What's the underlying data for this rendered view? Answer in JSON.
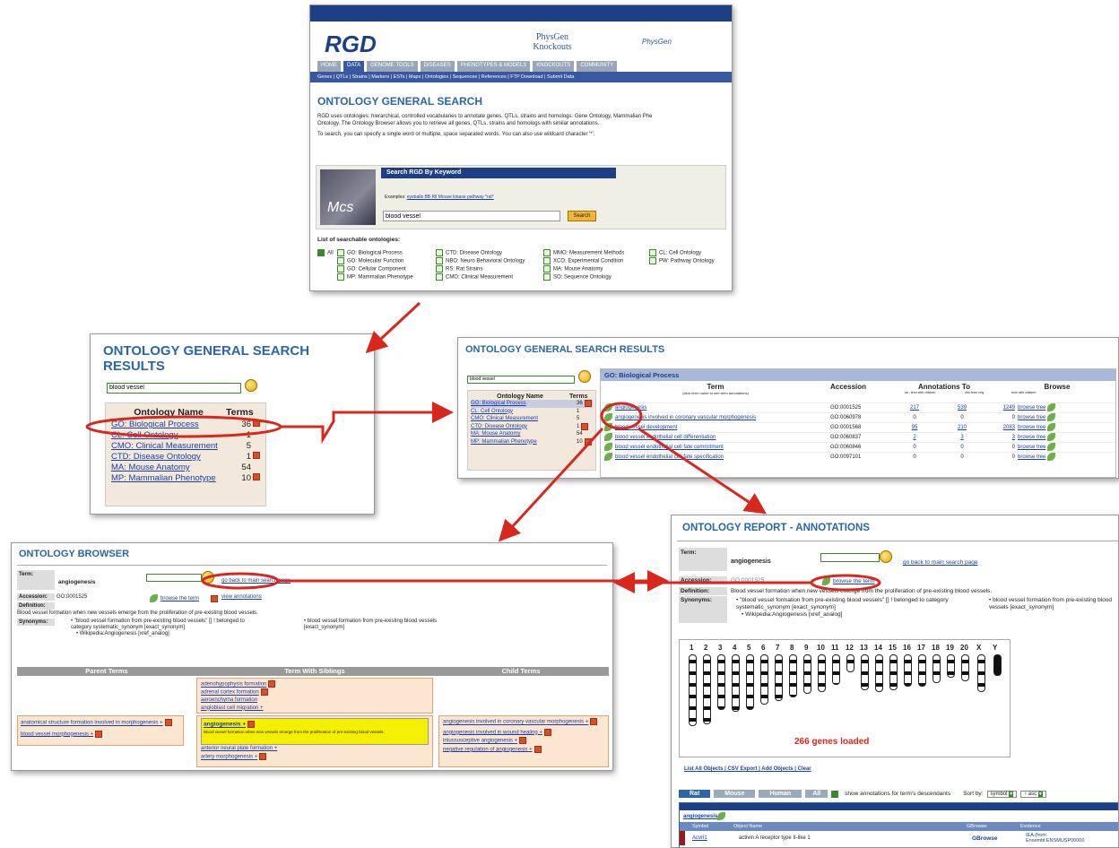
{
  "search_page": {
    "logo_text": "RGD",
    "physgen": "PhysGen Knockouts",
    "physgen2": "PhysGen",
    "nav_tabs": [
      "HOME",
      "DATA",
      "GENOME TOOLS",
      "DISEASES",
      "PHENOTYPES & MODELS",
      "KNOCKOUTS",
      "COMMUNITY"
    ],
    "subnav": "Genes | QTLs | Strains | Markers | ESTs | Maps | Ontologies | Sequences | References | FTP Download | Submit Data",
    "title": "ONTOLOGY GENERAL SEARCH",
    "intro1": "RGD uses ontologies: hierarchical, controlled vocabularies to annotate genes, QTLs, strains and homologs: Gene Ontology, Mammalian Phe",
    "intro2": "Ontology. The Ontology Browser allows you to retrieve all genes, QTLs, strains and homologs with similar annotations.",
    "intro3": "To search, you can specify a single word or multiple, space separated words. You can also use wildcard character '*'.",
    "keyword_header": "Search RGD By Keyword",
    "examples_label": "Examples:",
    "examples": "eyeballs  BB Rll Mouse  kinase pathway  *rat*",
    "search_value": "blood vessel",
    "search_button": "Search",
    "list_label": "List of searchable ontologies:",
    "all_label": "All",
    "ontologies": [
      [
        "GO: Biological Process",
        "CTD: Disease Ontology",
        "MMO: Measurement Methods",
        "CL: Cell Ontology"
      ],
      [
        "GO: Molecular Function",
        "NBO: Neuro Behavioral Ontology",
        "XCO: Experimental Condition",
        "PW: Pathway Ontology"
      ],
      [
        "GO: Cellular Component",
        "RS: Rat Strains",
        "MA: Mouse Anatomy",
        ""
      ],
      [
        "MP: Mammalian Phenotype",
        "CMO: Clinical Measurement",
        "SO: Sequence Ontology",
        ""
      ]
    ]
  },
  "results_small": {
    "title": "ONTOLOGY GENERAL SEARCH RESULTS",
    "search_value": "blood vessel",
    "col_name": "Ontology Name",
    "col_terms": "Terms",
    "rows": [
      [
        "GO: Biological Process",
        "36"
      ],
      [
        "CL: Cell Ontology",
        "1"
      ],
      [
        "CMO: Clinical Measurement",
        "5"
      ],
      [
        "CTD: Disease Ontology",
        "1"
      ],
      [
        "MA: Mouse Anatomy",
        "54"
      ],
      [
        "MP: Mammalian Phenotype",
        "10"
      ]
    ]
  },
  "results_full": {
    "title": "ONTOLOGY GENERAL SEARCH RESULTS",
    "search_value": "blood vessel",
    "section": "GO: Biological Process",
    "col_term": "Term",
    "col_term_hint": "(click term name to see term annotations)",
    "col_accession": "Accession",
    "col_annotations": "Annotations To",
    "col_browse": "Browse",
    "ann_sub1": "rat - term with children",
    "ann_sub2": "this term only",
    "browse_sub": "term with children",
    "browse_tree": "browse tree",
    "rows": [
      [
        "angiogenesis",
        "GO:0001525",
        "217",
        "539",
        "1249"
      ],
      [
        "angiogenesis involved in coronary vascular morphogenesis",
        "GO:0060978",
        "0",
        "0",
        "0"
      ],
      [
        "blood vessel development",
        "GO:0001568",
        "95",
        "210",
        "2083"
      ],
      [
        "blood vessel endothelial cell differentiation",
        "GO:0060837",
        "2",
        "3",
        "3"
      ],
      [
        "blood vessel endothelial cell fate commitment",
        "GO:0060846",
        "0",
        "0",
        "0"
      ],
      [
        "blood vessel endothelial cell fate specification",
        "GO:0097101",
        "0",
        "0",
        "0"
      ]
    ]
  },
  "browser": {
    "title": "ONTOLOGY BROWSER",
    "term_label": "Term:",
    "term": "angiogenesis",
    "back_link": "go back to main search page",
    "accession_label": "Accession:",
    "accession": "GO:0001525",
    "browse_term": "browse the term",
    "view_annotations": "view annotations",
    "definition_label": "Definition:",
    "definition": "Blood vessel formation when new vessels emerge from the proliferation of pre-existing blood vessels.",
    "synonyms_label": "Synonyms:",
    "syn1": "• \"blood vessel formation from pre-existing blood vessels\" [] ! belonged to category systematic_synonym   [exact_synonym]",
    "syn2": "• blood vessel formation from pre-existing blood vessels   [exact_synonym]",
    "syn3": "• Wikipedia:Angiogenesis   [xref_analog]",
    "col_parent": "Parent Terms",
    "col_siblings": "Term With Siblings",
    "col_child": "Child Terms",
    "parents": [
      "anatomical structure formation involved in morphogenesis +",
      "blood vessel morphogenesis +"
    ],
    "siblings_above": [
      "adenohypophysis formation",
      "adrenal cortex formation",
      "aeroenchyma formation",
      "angioblast cell migration +"
    ],
    "selected": "angiogenesis +",
    "selected_def": "Blood vessel formation when new vessels emerge from the proliferation of pre-existing blood vessels.",
    "siblings_below": [
      "anterior neural plate formation +",
      "artery morphogenesis +"
    ],
    "children": [
      "angiogenesis involved in coronary vascular morphogenesis +",
      "angiogenesis involved in wound healing +",
      "intussusceptive angiogenesis +",
      "negative regulation of angiogenesis +"
    ]
  },
  "report": {
    "title": "ONTOLOGY REPORT - ANNOTATIONS",
    "term_label": "Term:",
    "term": "angiogenesis",
    "back_link": "go back to main search page",
    "accession_label": "Accession:",
    "accession": "GO:0001525",
    "browse_term": "browse the term",
    "definition_label": "Definition:",
    "definition": "Blood vessel formation when new vessels emerge from the proliferation of pre-existing blood vessels.",
    "synonyms_label": "Synonyms:",
    "syn1": "• \"blood vessel formation from pre-existing blood vessels\" [] ! belonged to category systematic_synonym   [exact_synonym]",
    "syn2": "• blood vessel formation from pre-existing blood vessels   [exact_synonym]",
    "syn3": "• Wikipedia:Angiogenesis   [xref_analog]",
    "chromosomes": [
      "1",
      "2",
      "3",
      "4",
      "5",
      "6",
      "7",
      "8",
      "9",
      "10",
      "11",
      "12",
      "13",
      "14",
      "15",
      "16",
      "17",
      "18",
      "19",
      "20",
      "X",
      "Y"
    ],
    "genes_loaded": "266 genes loaded",
    "links": "List All Objects | CSV Export | Add Objects | Clear",
    "species_tabs": [
      "Rat",
      "Mouse",
      "Human",
      "All"
    ],
    "show_desc": "show annotations for term's descendants",
    "sort_label": "Sort by:",
    "sort_value": "symbol",
    "sort_order": "↑ asc",
    "table_term": "angiogenesis",
    "col_symbol": "Symbol",
    "col_object": "Object Name",
    "col_gbrowse": "GBrowse",
    "col_evidence": "Evidence",
    "row_symbol": "Acvrl1",
    "row_object": "activin A receptor type II-like 1",
    "row_gbrowse": "GBrowse",
    "row_evidence1": "IEA (from",
    "row_evidence2": "Ensembl:ENSMUSP00000"
  }
}
